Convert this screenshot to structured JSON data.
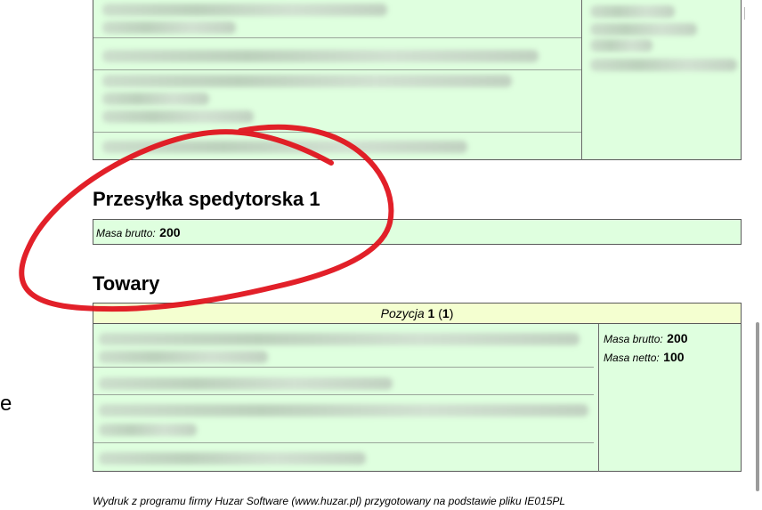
{
  "sections": {
    "consignment_title": "Przesyłka spedytorska 1",
    "consignment_gross_label": "Masa brutto:",
    "consignment_gross_value": "200",
    "goods_title": "Towary"
  },
  "position": {
    "label": "Pozycja",
    "number": "1",
    "count": "1",
    "gross_label": "Masa brutto:",
    "gross_value": "200",
    "net_label": "Masa netto:",
    "net_value": "100"
  },
  "footer": {
    "text": "Wydruk z programu firmy Huzar Software (www.huzar.pl) przygotowany na podstawie pliku IE015PL"
  },
  "colors": {
    "panel_green": "#dfffdf",
    "header_yellow": "#f4ffd0",
    "annotation_red": "#e0141e"
  }
}
